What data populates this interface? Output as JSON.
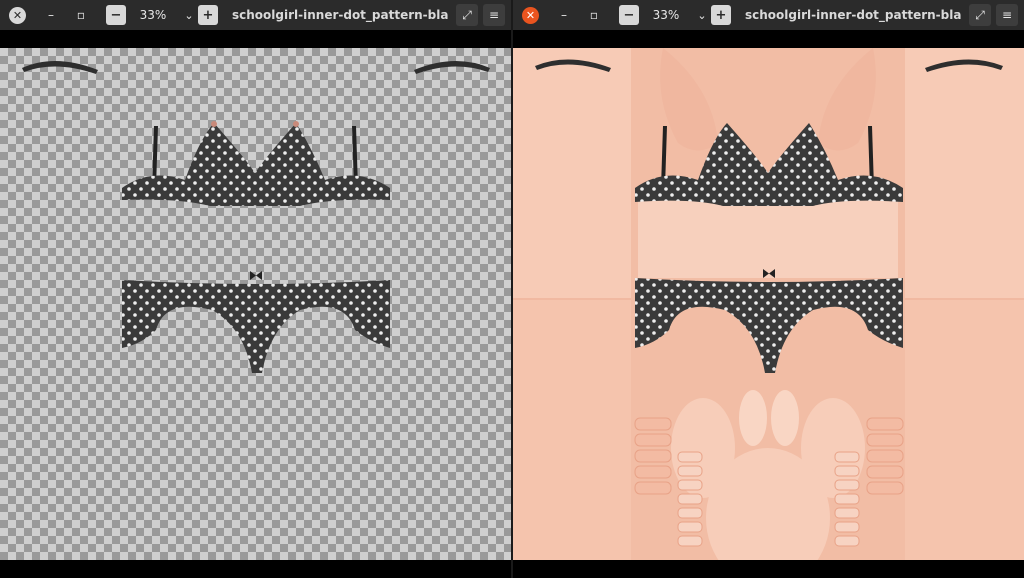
{
  "left_window": {
    "close_icon": "✕",
    "minimize_icon": "–",
    "maximize_icon": "▫",
    "zoom_out_icon": "−",
    "zoom": "33%",
    "zoom_dropdown_icon": "⌄",
    "zoom_in_icon": "+",
    "title": "schoolgirl-inner-dot_pattern-black-Lay...",
    "fullscreen_icon": "⤢",
    "menu_icon": "≡"
  },
  "right_window": {
    "close_icon": "✕",
    "minimize_icon": "–",
    "maximize_icon": "▫",
    "zoom_out_icon": "−",
    "zoom": "33%",
    "zoom_dropdown_icon": "⌄",
    "zoom_in_icon": "+",
    "title": "schoolgirl-inner-dot_pattern-black-Ful...",
    "fullscreen_icon": "⤢",
    "menu_icon": "≡"
  },
  "colors": {
    "titlebar": "#2b2b2b",
    "close_active": "#e9541f",
    "skin": "#f1b9a1",
    "fabric": "#3a3a3a",
    "dots": "#eeeeee"
  }
}
